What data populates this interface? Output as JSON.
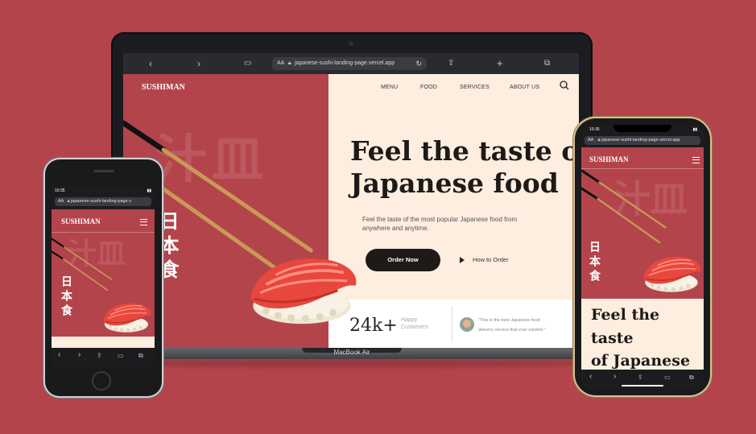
{
  "laptop": {
    "model_label": "MacBook Air",
    "browser": {
      "text_size_label": "AA",
      "url": "japanese-sushi-landing-page.vercel.app",
      "icons": [
        "chevron-left-icon",
        "chevron-right-icon",
        "book-icon",
        "lock-icon",
        "reload-icon",
        "share-icon",
        "plus-icon",
        "tabs-icon"
      ]
    },
    "site": {
      "brand": "SUSHIMAN",
      "nav": [
        "MENU",
        "FOOD",
        "SERVICES",
        "ABOUT US"
      ],
      "headline_line1": "Feel the taste of",
      "headline_line2": "Japanese food",
      "subtitle_line1": "Feel the taste of the most popular Japanese food from",
      "subtitle_line2": "anywhere and anytime.",
      "order_button": "Order Now",
      "how_to_order": "How to Order",
      "stat_value": "24k+",
      "stat_label_line1": "Happy",
      "stat_label_line2": "Customers",
      "testimonial_line1": "\"This is the best Japanese food",
      "testimonial_line2": "delivery service that ever existed.\""
    }
  },
  "phone_small": {
    "time": "10:35",
    "text_size_label": "AA",
    "url": "japanese-sushi-landing-page.v",
    "brand": "SUSHIMAN",
    "kanji": "日本食"
  },
  "phone_large": {
    "time": "10:35",
    "text_size_label": "AA",
    "url": "japanese-sushi-landing-page.vercel.app",
    "brand": "SUSHIMAN",
    "kanji": "日本食",
    "headline_line1": "Feel the taste",
    "headline_line2": "of Japanese",
    "headline_line3": "food"
  },
  "colors": {
    "background": "#b4444c",
    "cream": "#fdeee0",
    "dark": "#1d1a18",
    "tuna": "#e8473e",
    "rice": "#f4ede0"
  }
}
